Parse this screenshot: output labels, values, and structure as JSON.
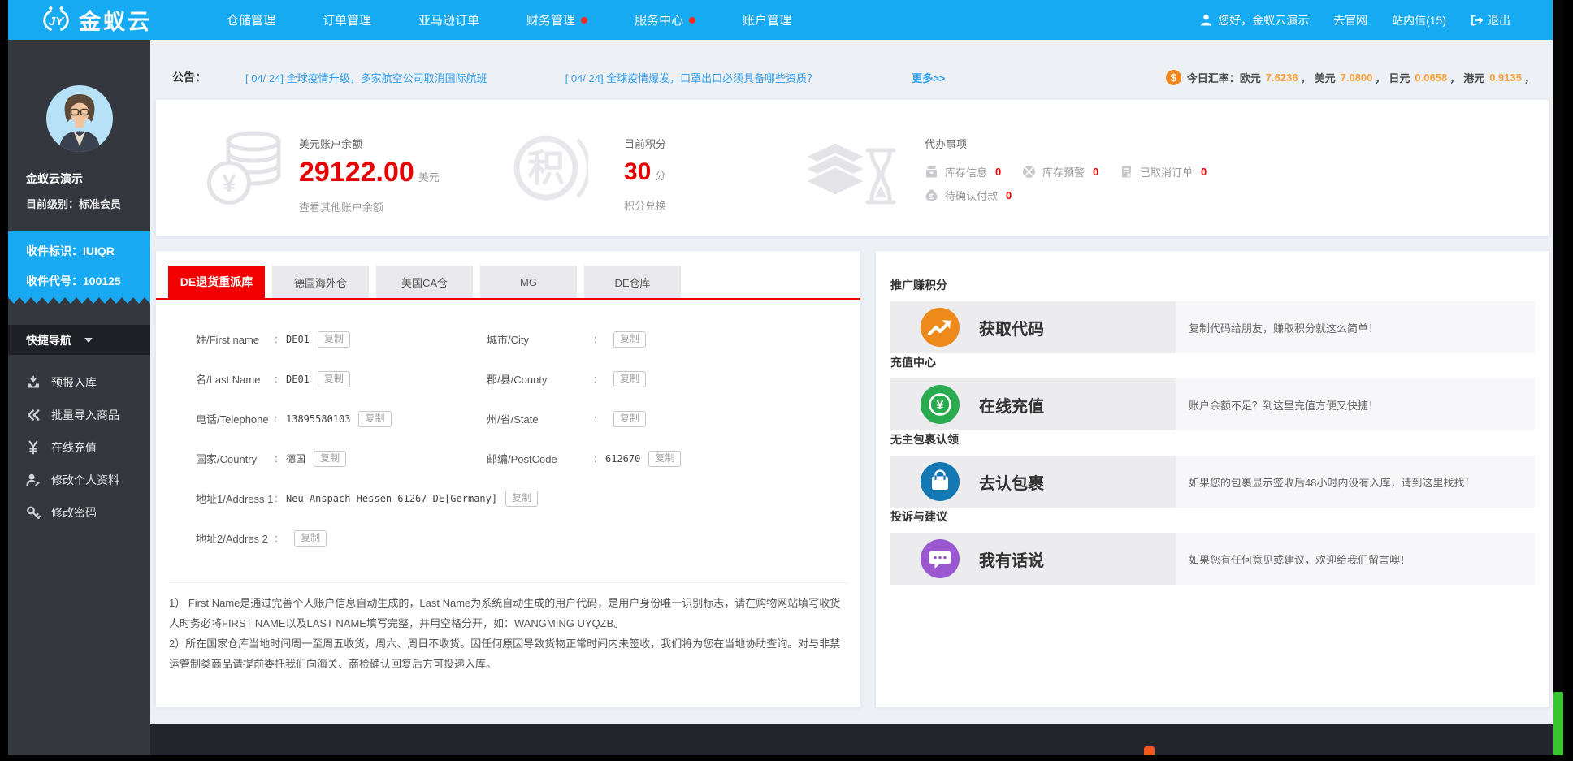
{
  "colors": {
    "navbar_blue": "#16aaf3",
    "sidebar_dark": "#35373e",
    "accent_red": "#f20000",
    "link_blue": "#2f9ff0",
    "rate_orange": "#f7a23c",
    "highlight_blue": "#18a9f2"
  },
  "navbar": {
    "brand": "金蚁云",
    "menu": [
      {
        "label": "仓储管理",
        "dot": false
      },
      {
        "label": "订单管理",
        "dot": false
      },
      {
        "label": "亚马逊订单",
        "dot": false
      },
      {
        "label": "财务管理",
        "dot": true
      },
      {
        "label": "服务中心",
        "dot": true
      },
      {
        "label": "账户管理",
        "dot": false
      }
    ],
    "greeting": "您好，金蚁云演示",
    "official_site": "去官网",
    "site_mail": "站内信(15)",
    "logout": "退出"
  },
  "announcement": {
    "label": "公告：",
    "news": [
      "[ 04/ 24] 全球疫情升级，多家航空公司取消国际航班",
      "[ 04/ 24] 全球疫情爆发，口罩出口必须具备哪些资质？"
    ],
    "more": "更多>>",
    "rates_symbol": "$",
    "rates_label": "今日汇率：",
    "rates_separator": "，",
    "rates": [
      {
        "currency": "欧元",
        "value": "7.6236"
      },
      {
        "currency": "美元",
        "value": "7.0800"
      },
      {
        "currency": "日元",
        "value": "0.0658"
      },
      {
        "currency": "港元",
        "value": "0.9135"
      }
    ]
  },
  "sidebar": {
    "username": "金蚁云演示",
    "level_label": "目前级别：",
    "level": "标准会员",
    "receive_id": "收件标识：IUIQR",
    "receive_code": "收件代号：100125",
    "quick_nav": "快捷导航",
    "menu": [
      "预报入库",
      "批量导入商品",
      "在线充值",
      "修改个人资料",
      "修改密码"
    ]
  },
  "overview": {
    "balance": {
      "icon_char": "¥",
      "title": "美元账户余额",
      "amount": "29122.00",
      "unit": "美元",
      "link": "查看其他账户余额"
    },
    "points": {
      "icon_char": "积",
      "title": "目前积分",
      "amount": "30",
      "unit": "分",
      "link": "积分兑换"
    },
    "todo": {
      "title": "代办事项",
      "items": [
        {
          "label": "库存信息",
          "count": "0"
        },
        {
          "label": "库存预警",
          "count": "0"
        },
        {
          "label": "已取消订单",
          "count": "0"
        },
        {
          "label": "待确认付款",
          "count": "0"
        }
      ]
    }
  },
  "warehouse": {
    "tabs": [
      "DE退货重派库",
      "德国海外仓",
      "美国CA仓",
      "MG",
      "DE仓库"
    ],
    "copy_label": "复制",
    "left_fields": [
      {
        "label": "姓/First name",
        "value": "DE01"
      },
      {
        "label": "名/Last Name",
        "value": "DE01"
      },
      {
        "label": "电话/Telephone",
        "value": "13895580103"
      },
      {
        "label": "国家/Country",
        "value": "德国"
      },
      {
        "label": "地址1/Address 1",
        "value": "Neu-Anspach Hessen 61267 DE[Germany]"
      },
      {
        "label": "地址2/Addres 2",
        "value": ""
      }
    ],
    "right_fields": [
      {
        "label": "城市/City",
        "value": ""
      },
      {
        "label": "郡/县/County",
        "value": ""
      },
      {
        "label": "州/省/State",
        "value": ""
      },
      {
        "label": "邮编/PostCode",
        "value": "612670"
      }
    ],
    "notes": [
      "1） First Name是通过完善个人账户信息自动生成的，Last Name为系统自动生成的用户代码，是用户身份唯一识别标志，请在购物网站填写收货人时务必将FIRST NAME以及LAST NAME填写完整，并用空格分开，如：WANGMING UYQZB。",
      "2）所在国家仓库当地时间周一至周五收货，周六、周日不收货。因任何原因导致货物正常时间内未签收，我们将为您在当地协助查询。对与非禁运管制类商品请提前委托我们向海关、商检确认回复后方可投递入库。"
    ]
  },
  "promos": [
    {
      "header": "推广赚积分",
      "title": "获取代码",
      "desc": "复制代码给朋友，赚取积分就这么简单！",
      "accent": "#ee8a1c"
    },
    {
      "header": "充值中心",
      "title": "在线充值",
      "desc": "账户余额不足？到这里充值方便又快捷！",
      "accent": "#2bab50",
      "icon_char": "¥"
    },
    {
      "header": "无主包裹认领",
      "title": "去认包裹",
      "desc": "如果您的包裹显示签收后48小时内没有入库，请到这里找找！",
      "accent": "#1478b4"
    },
    {
      "header": "投诉与建议",
      "title": "我有话说",
      "desc": "如果您有任何意见或建议，欢迎给我们留言噢！",
      "accent": "#9a57cf"
    }
  ]
}
